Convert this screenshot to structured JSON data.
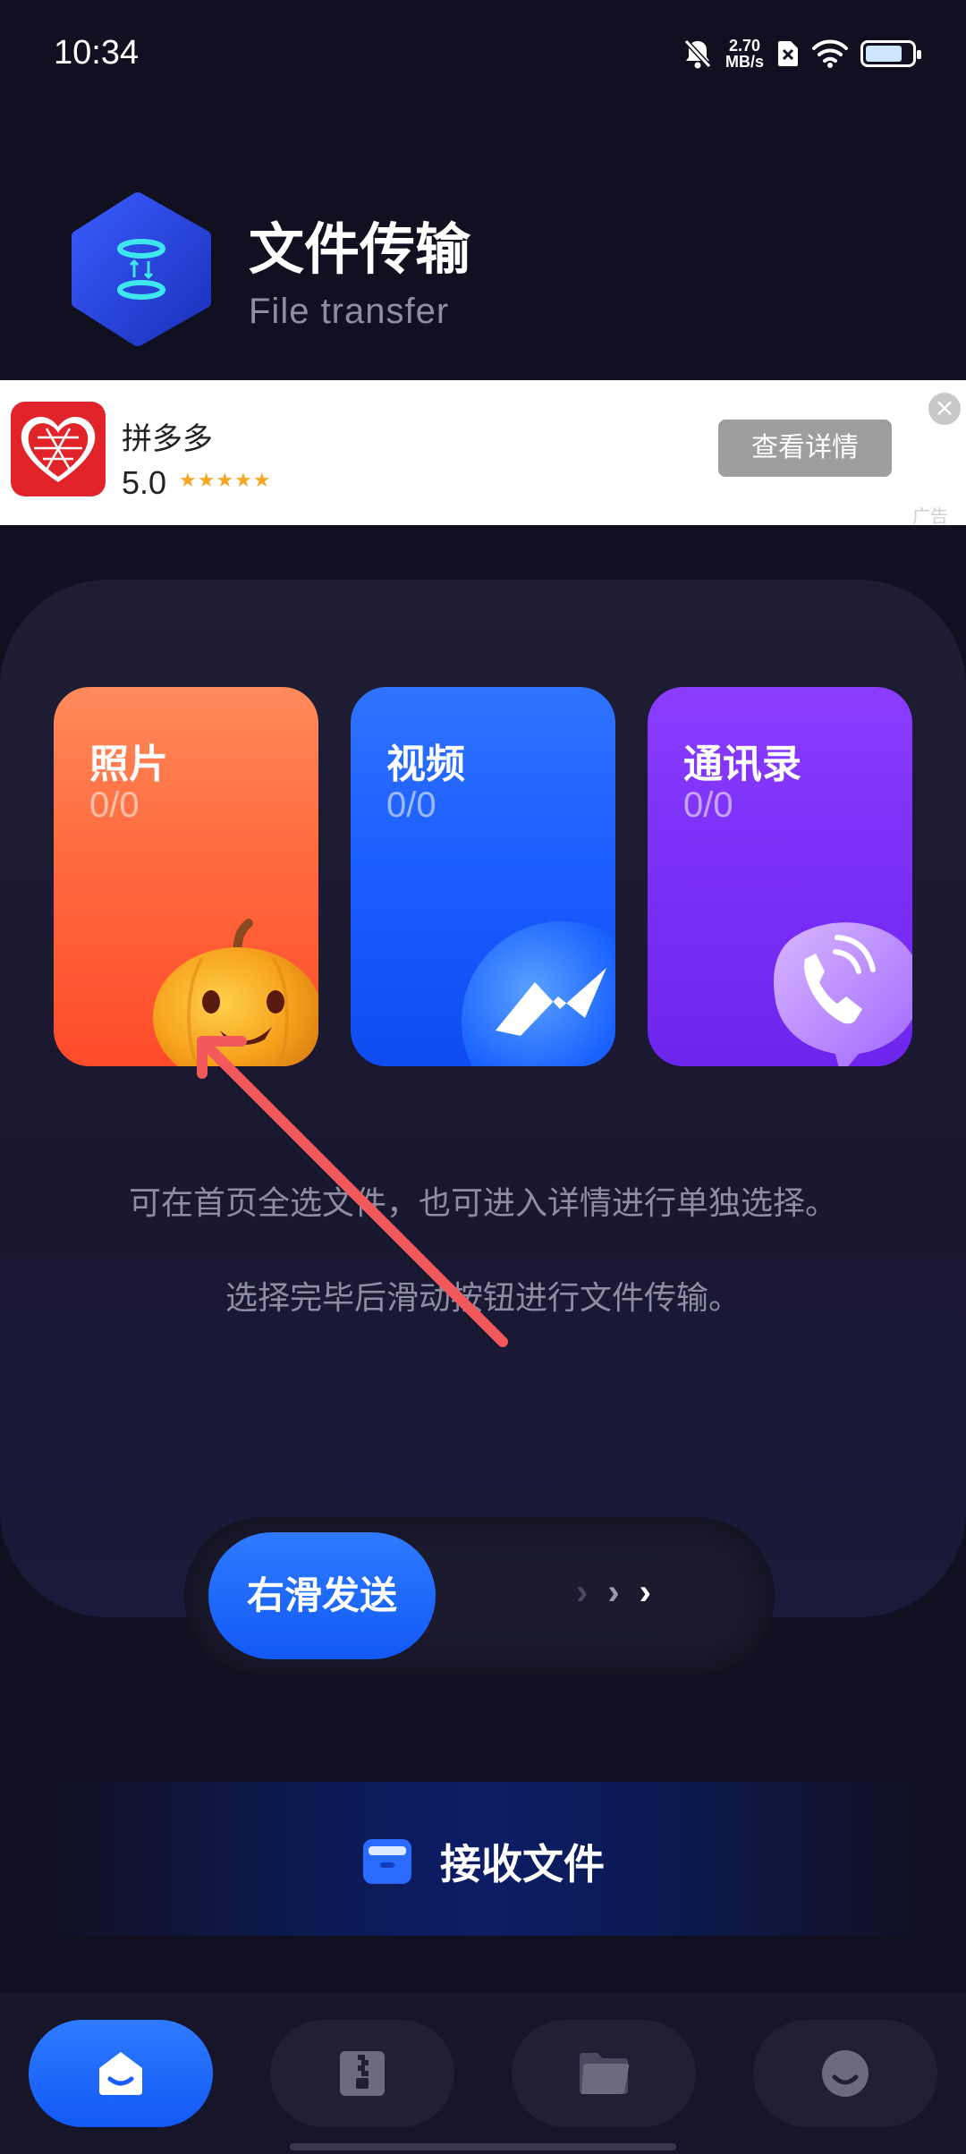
{
  "status_bar": {
    "time": "10:34",
    "net_speed_value": "2.70",
    "net_speed_unit": "MB/s",
    "battery_level": 0.8,
    "icons": [
      "bell-off-icon",
      "sim-x-icon",
      "wifi-icon",
      "battery-icon"
    ]
  },
  "header": {
    "title": "文件传输",
    "subtitle": "File transfer"
  },
  "ad": {
    "app_name": "拼多多",
    "rating": "5.0",
    "stars": "★★★★★",
    "button_label": "查看详情",
    "close_symbol": "×",
    "label": "广告"
  },
  "cards": [
    {
      "title": "照片",
      "count": "0/0",
      "icon": "pumpkin-icon"
    },
    {
      "title": "视频",
      "count": "0/0",
      "icon": "play-wave-icon"
    },
    {
      "title": "通讯录",
      "count": "0/0",
      "icon": "phone-icon"
    }
  ],
  "hints": {
    "line1": "可在首页全选文件，也可进入详情进行单独选择。",
    "line2": "选择完毕后滑动按钮进行文件传输。"
  },
  "slider": {
    "label": "右滑发送",
    "arrows": [
      "›",
      "›",
      "›"
    ]
  },
  "receive": {
    "label": "接收文件",
    "icon": "folder-icon"
  },
  "bottom_nav": [
    {
      "name": "home",
      "icon": "home-icon",
      "active": true
    },
    {
      "name": "archive",
      "icon": "archive-icon",
      "active": false
    },
    {
      "name": "files",
      "icon": "folder-icon",
      "active": false
    },
    {
      "name": "profile",
      "icon": "smile-icon",
      "active": false
    }
  ],
  "colors": {
    "background": "#111021",
    "accent_blue": "#1a5cff",
    "photos_card": "#ff6a3d",
    "videos_card": "#1a5cff",
    "contacts_card": "#7a2ff7",
    "annotation_arrow": "#f2595b"
  }
}
